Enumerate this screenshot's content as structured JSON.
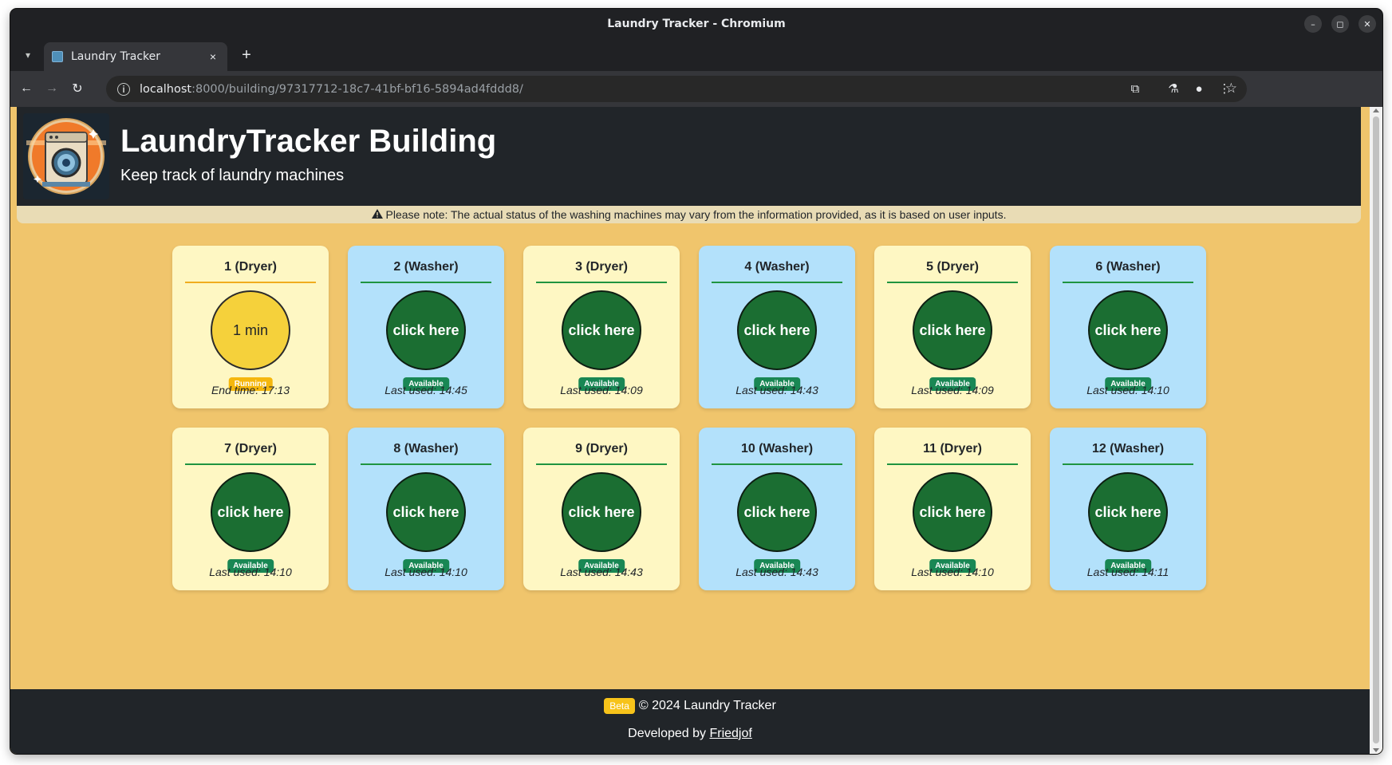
{
  "window": {
    "title": "Laundry Tracker - Chromium"
  },
  "window_controls": {
    "minimize": "–",
    "maximize": "◻",
    "close": "✕"
  },
  "tab": {
    "title": "Laundry Tracker",
    "close": "×"
  },
  "new_tab": "+",
  "address": {
    "host": "localhost",
    "path": ":8000/building/97317712-18c7-41bf-bf16-5894ad4fddd8/"
  },
  "header": {
    "title": "LaundryTracker Building",
    "subtitle": "Keep track of laundry machines"
  },
  "notice": "Please note: The actual status of the washing machines may vary from the information provided, as it is based on user inputs.",
  "machines": [
    {
      "label": "1 (Dryer)",
      "kind": "dryer",
      "circle": "1 min",
      "status": "Running",
      "foot": "End time: 17:13"
    },
    {
      "label": "2 (Washer)",
      "kind": "washer",
      "circle": "click here",
      "status": "Available",
      "foot": "Last used: 14:45"
    },
    {
      "label": "3 (Dryer)",
      "kind": "dryer",
      "circle": "click here",
      "status": "Available",
      "foot": "Last used: 14:09"
    },
    {
      "label": "4 (Washer)",
      "kind": "washer",
      "circle": "click here",
      "status": "Available",
      "foot": "Last used: 14:43"
    },
    {
      "label": "5 (Dryer)",
      "kind": "dryer",
      "circle": "click here",
      "status": "Available",
      "foot": "Last used: 14:09"
    },
    {
      "label": "6 (Washer)",
      "kind": "washer",
      "circle": "click here",
      "status": "Available",
      "foot": "Last used: 14:10"
    },
    {
      "label": "7 (Dryer)",
      "kind": "dryer",
      "circle": "click here",
      "status": "Available",
      "foot": "Last used: 14:10"
    },
    {
      "label": "8 (Washer)",
      "kind": "washer",
      "circle": "click here",
      "status": "Available",
      "foot": "Last used: 14:10"
    },
    {
      "label": "9 (Dryer)",
      "kind": "dryer",
      "circle": "click here",
      "status": "Available",
      "foot": "Last used: 14:43"
    },
    {
      "label": "10 (Washer)",
      "kind": "washer",
      "circle": "click here",
      "status": "Available",
      "foot": "Last used: 14:43"
    },
    {
      "label": "11 (Dryer)",
      "kind": "dryer",
      "circle": "click here",
      "status": "Available",
      "foot": "Last used: 14:10"
    },
    {
      "label": "12 (Washer)",
      "kind": "washer",
      "circle": "click here",
      "status": "Available",
      "foot": "Last used: 14:11"
    }
  ],
  "footer": {
    "beta": "Beta",
    "copyright": "© 2024 Laundry Tracker",
    "developed_by": "Developed by",
    "developer": "Friedjof"
  },
  "colors": {
    "page_bg": "#f0c56c",
    "header_bg": "#212529",
    "dryer_card": "#fef7c3",
    "washer_card": "#b3e1fb",
    "available": "#198754",
    "running": "#f5b70d",
    "machine_circle": "#1b6e32",
    "running_circle": "#f5d13b"
  },
  "icons": {
    "tab_favicon": "washing-machine-favicon",
    "back": "arrow-left-icon",
    "forward": "arrow-right-icon",
    "reload": "reload-icon",
    "site_info": "info-icon",
    "bookmark": "star-icon",
    "extensions": "puzzle-icon",
    "labs": "flask-icon",
    "profile": "person-icon",
    "menu": "kebab-menu-icon",
    "warning": "warning-triangle-icon"
  }
}
